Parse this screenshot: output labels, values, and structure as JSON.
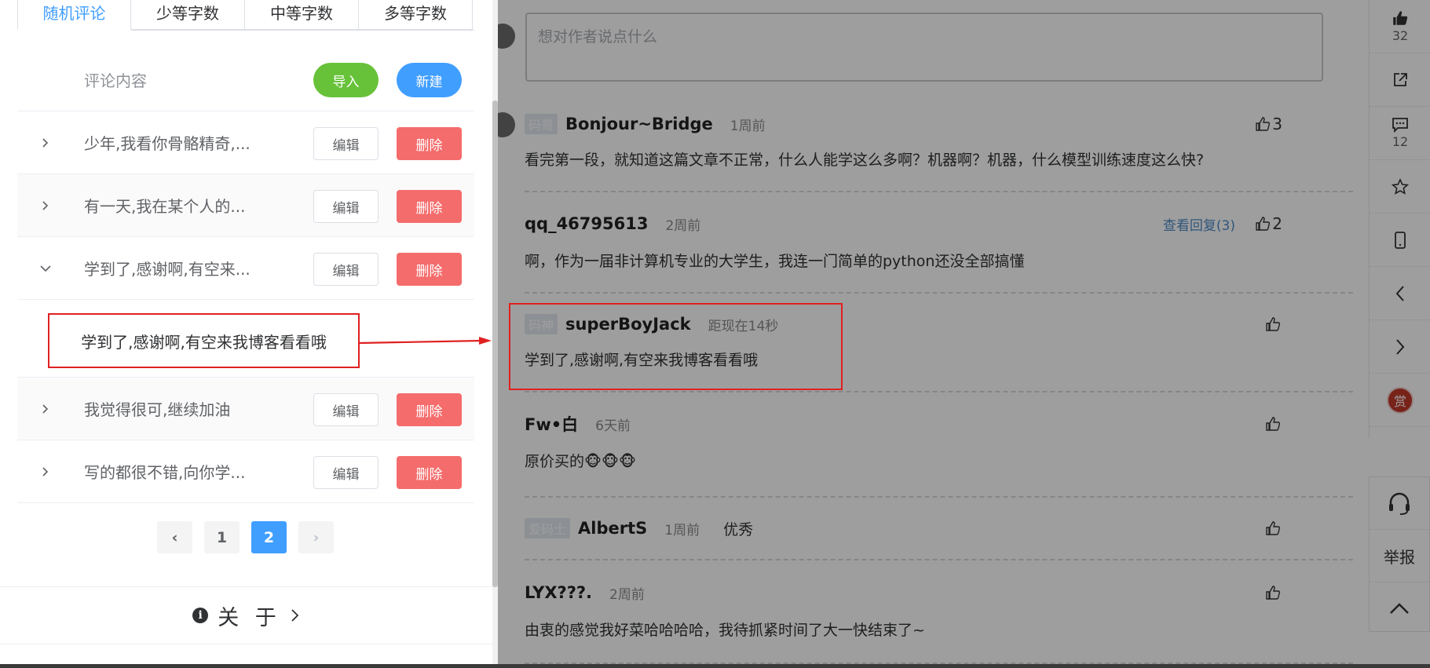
{
  "left": {
    "tabs": [
      "随机评论",
      "少等字数",
      "中等字数",
      "多等字数"
    ],
    "header": {
      "column_label": "评论内容",
      "import_label": "导入",
      "new_label": "新建"
    },
    "rows": [
      {
        "text": "少年,我看你骨骼精奇,...",
        "edit": "编辑",
        "delete": "删除"
      },
      {
        "text": "有一天,我在某个人的...",
        "edit": "编辑",
        "delete": "删除"
      },
      {
        "text": "学到了,感谢啊,有空来...",
        "edit": "编辑",
        "delete": "删除"
      },
      {
        "text": "我觉得很可,继续加油",
        "edit": "编辑",
        "delete": "删除"
      },
      {
        "text": "写的都很不错,向你学...",
        "edit": "编辑",
        "delete": "删除"
      }
    ],
    "expanded_text": "学到了,感谢啊,有空来我博客看看哦",
    "pager": {
      "prev": "‹",
      "pages": [
        "1",
        "2"
      ],
      "current": "2",
      "next": "›"
    },
    "about_label": "关 于"
  },
  "right": {
    "input_placeholder": "想对作者说点什么",
    "comments": [
      {
        "badge": "码哥",
        "user": "Bonjour~Bridge",
        "time": "1周前",
        "body": "看完第一段，就知道这篇文章不正常，什么人能学这么多啊？机器啊？机器，什么模型训练速度这么快?",
        "likes": "3"
      },
      {
        "badge": "",
        "user": "qq_46795613",
        "time": "2周前",
        "body": "啊，作为一届非计算机专业的大学生，我连一门简单的python还没全部搞懂",
        "likes": "2",
        "replies": "查看回复(3)"
      },
      {
        "badge": "码神",
        "user": "superBoyJack",
        "time": "距现在14秒",
        "body": "学到了,感谢啊,有空来我博客看看哦",
        "likes": ""
      },
      {
        "badge": "",
        "user": "Fw•白",
        "time": "6天前",
        "body": "原价买的🐵🐵🐵",
        "likes": ""
      },
      {
        "badge": "爱码士",
        "user": "AlbertS",
        "time": "1周前",
        "inline": "优秀",
        "likes": ""
      },
      {
        "badge": "",
        "user": "LYX???.",
        "time": "2周前",
        "body": "由衷的感觉我好菜哈哈哈哈，我待抓紧时间了大一快结束了~",
        "likes": ""
      }
    ],
    "sidebar": {
      "like_count": "32",
      "comment_count": "12",
      "reward": "赏",
      "report": "举报"
    }
  },
  "colors": {
    "primary": "#409eff",
    "success": "#67c23a",
    "danger": "#f56c6c",
    "highlight": "#e02020"
  }
}
